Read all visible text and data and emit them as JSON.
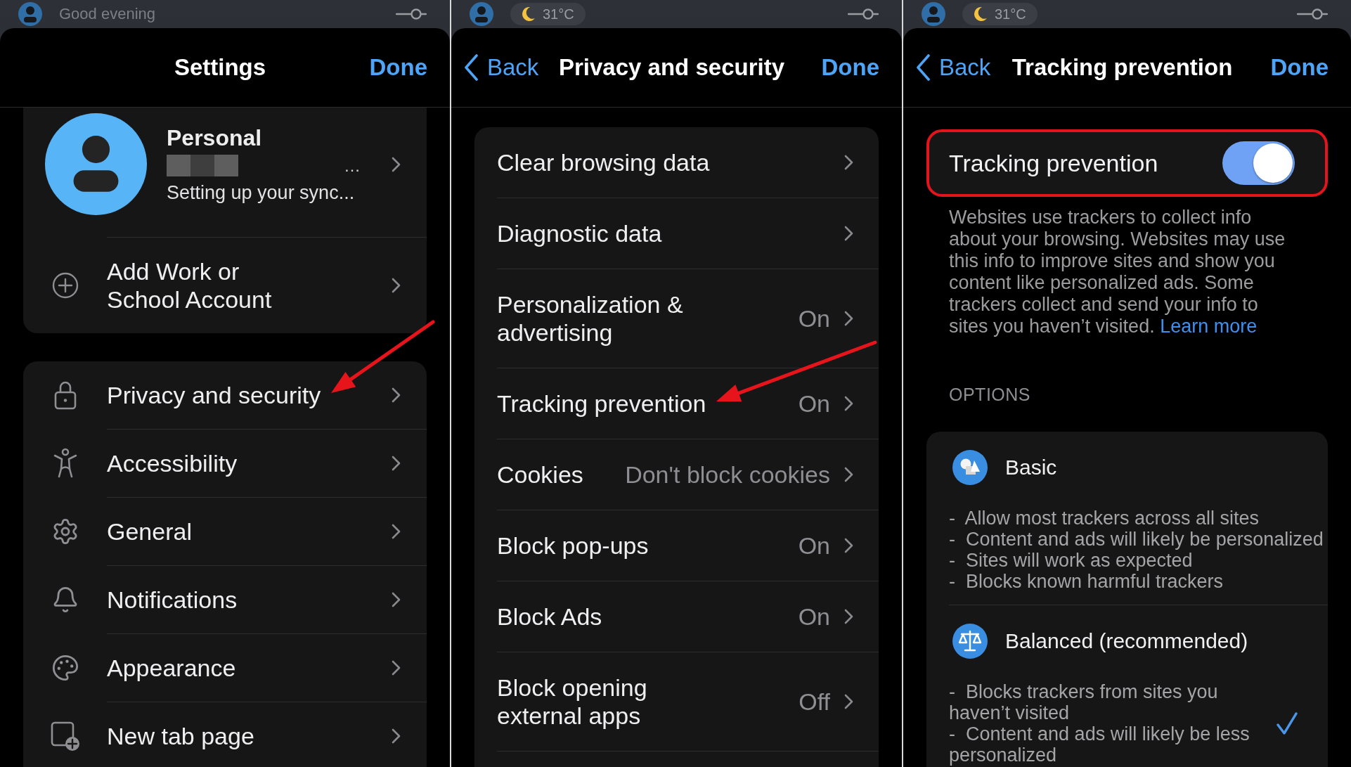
{
  "panels": [
    {
      "kind": "settings",
      "top_bar": {
        "greeting": "Good evening"
      },
      "header": {
        "title": "Settings",
        "done": "Done"
      },
      "profile": {
        "name": "Personal",
        "email": "…",
        "email_redacted": true,
        "status": "Setting up your sync..."
      },
      "groups": [
        {
          "items": [
            {
              "label": "Add Work or School Account",
              "pointer": false
            }
          ]
        },
        {
          "items": [
            {
              "label": "Privacy and security",
              "pointer": true
            },
            {
              "label": "Accessibility",
              "pointer": false
            },
            {
              "label": "General",
              "pointer": false
            },
            {
              "label": "Notifications",
              "pointer": false
            },
            {
              "label": "Appearance",
              "pointer": false
            },
            {
              "label": "New tab page",
              "pointer": false
            }
          ]
        }
      ]
    },
    {
      "kind": "privacy",
      "top_bar": {
        "weather": "31°C"
      },
      "header": {
        "back": "Back",
        "title": "Privacy and security",
        "done": "Done"
      },
      "items": [
        {
          "label": "Clear browsing data",
          "pointer": false
        },
        {
          "label": "Diagnostic data",
          "pointer": false
        },
        {
          "label": "Personalization & advertising",
          "value": "On",
          "pointer": false
        },
        {
          "label": "Tracking prevention",
          "value": "On",
          "pointer": true
        },
        {
          "label": "Cookies",
          "value": "Don't block cookies",
          "pointer": false
        },
        {
          "label": "Block pop-ups",
          "value": "On",
          "pointer": false
        },
        {
          "label": "Block Ads",
          "value": "On",
          "pointer": false
        },
        {
          "label": "Block opening external apps",
          "value": "Off",
          "pointer": false
        }
      ]
    },
    {
      "kind": "tracking",
      "top_bar": {
        "weather": "31°C"
      },
      "header": {
        "back": "Back",
        "title": "Tracking prevention",
        "done": "Done"
      },
      "toggle": {
        "label": "Tracking prevention",
        "on": true,
        "highlighted": true
      },
      "description": "Websites use trackers to collect info about your browsing. Websites may use this info to improve sites and show you content like personalized ads. Some trackers collect and send your info to sites you haven’t visited.",
      "link": "Learn more",
      "options_heading": "OPTIONS",
      "options": [
        {
          "title": "Basic",
          "selected": false,
          "points": [
            "-  Allow most trackers across all sites",
            "-  Content and ads will likely be personalized",
            "-  Sites will work as expected",
            "-  Blocks known harmful trackers"
          ]
        },
        {
          "title": "Balanced (recommended)",
          "selected": true,
          "points": [
            "-  Blocks trackers from sites you haven’t visited",
            "-  Content and ads will likely be less personalized"
          ]
        }
      ]
    }
  ]
}
